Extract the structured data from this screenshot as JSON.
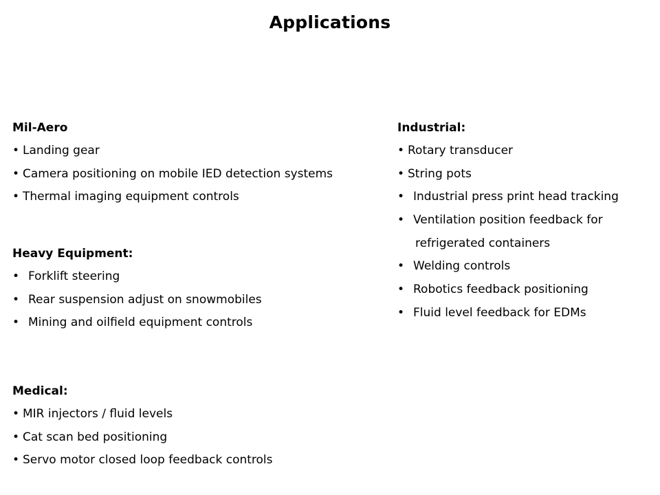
{
  "slide": {
    "title": "Applications"
  },
  "sections": {
    "mil_aero": {
      "heading": "Mil-Aero",
      "bullet": "•",
      "items": [
        "Landing gear",
        "Camera positioning on mobile IED detection systems",
        "Thermal imaging equipment controls"
      ]
    },
    "heavy_equipment": {
      "heading": "Heavy Equipment:",
      "bullet": "•",
      "items": [
        "Forklift steering",
        "Rear suspension adjust on snowmobiles",
        "Mining and oilfield equipment controls"
      ]
    },
    "medical": {
      "heading": "Medical:",
      "bullet": "•",
      "items": [
        "MIR injectors / fluid levels",
        "Cat scan bed positioning",
        "Servo motor closed loop feedback controls"
      ]
    },
    "industrial": {
      "heading": "Industrial:",
      "bullet": "•",
      "items": [
        "Rotary transducer",
        "String pots",
        "Industrial press print head tracking",
        "Ventilation position feedback for",
        "refrigerated containers",
        "Welding controls",
        "Robotics feedback positioning",
        "Fluid level feedback for EDMs"
      ]
    }
  }
}
